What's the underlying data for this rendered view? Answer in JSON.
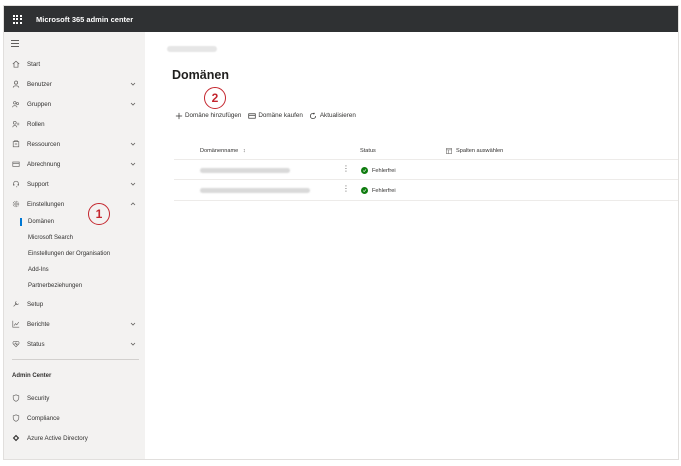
{
  "app": {
    "title": "Microsoft 365 admin center"
  },
  "sidebar": {
    "items": [
      {
        "label": "Start",
        "icon": "home-icon"
      },
      {
        "label": "Benutzer",
        "icon": "user-icon"
      },
      {
        "label": "Gruppen",
        "icon": "group-icon"
      },
      {
        "label": "Rollen",
        "icon": "roles-icon"
      },
      {
        "label": "Ressourcen",
        "icon": "resources-icon"
      },
      {
        "label": "Abrechnung",
        "icon": "billing-icon"
      },
      {
        "label": "Support",
        "icon": "support-icon"
      },
      {
        "label": "Einstellungen",
        "icon": "settings-icon"
      }
    ],
    "settings_sub": [
      {
        "label": "Domänen"
      },
      {
        "label": "Microsoft Search"
      },
      {
        "label": "Einstellungen der Organisation"
      },
      {
        "label": "Add-Ins"
      },
      {
        "label": "Partnerbeziehungen"
      }
    ],
    "items2": [
      {
        "label": "Setup",
        "icon": "setup-icon"
      },
      {
        "label": "Berichte",
        "icon": "reports-icon"
      },
      {
        "label": "Status",
        "icon": "health-icon"
      }
    ],
    "admin_center_title": "Admin Center",
    "admin_centers": [
      {
        "label": "Security",
        "icon": "shield-icon"
      },
      {
        "label": "Compliance",
        "icon": "shield-icon"
      },
      {
        "label": "Azure Active Directory",
        "icon": "azure-ad-icon"
      }
    ]
  },
  "callouts": {
    "one": "1",
    "two": "2"
  },
  "main": {
    "title": "Domänen",
    "commands": {
      "add": "Domäne hinzufügen",
      "buy": "Domäne kaufen",
      "refresh": "Aktualisieren"
    },
    "columns": {
      "name": "Domänenname",
      "name_sort": "↕",
      "status": "Status",
      "choose_columns": "Spalten auswählen"
    },
    "rows": [
      {
        "status": "Fehlerfrei"
      },
      {
        "status": "Fehlerfrei"
      }
    ]
  },
  "colors": {
    "accent": "#0078d4",
    "topbar": "#2f3133",
    "success": "#107c10",
    "callout": "#c4262e"
  }
}
